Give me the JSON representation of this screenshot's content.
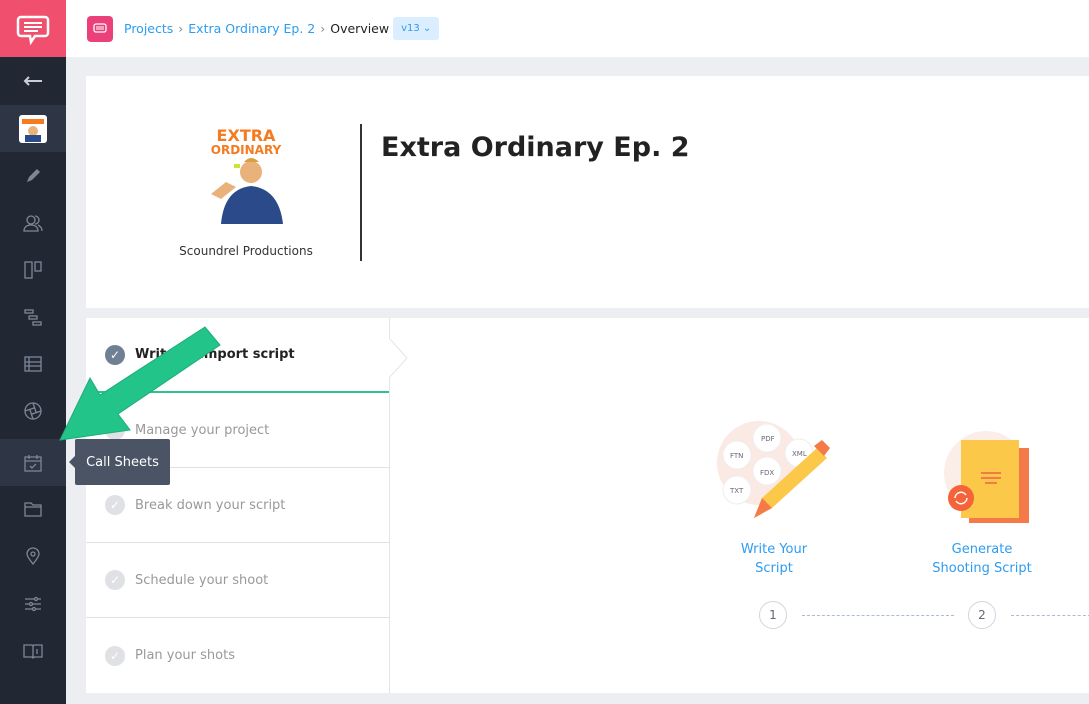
{
  "breadcrumb": {
    "items": [
      "Projects",
      "Extra Ordinary Ep. 2"
    ],
    "current": "Overview",
    "version": "v13 ⌄"
  },
  "project": {
    "title": "Extra Ordinary Ep. 2",
    "company": "Scoundrel Productions",
    "poster_text": "EXTRA ORDINARY"
  },
  "sidebar": {
    "items": [
      "back",
      "project",
      "script",
      "cast",
      "board",
      "schedule",
      "breakdown",
      "shots",
      "call-sheets",
      "files",
      "locations",
      "settings",
      "help"
    ],
    "tooltip": "Call Sheets"
  },
  "steps": [
    {
      "label": "Write or import script",
      "active": true
    },
    {
      "label": "Manage your project"
    },
    {
      "label": "Break down your script"
    },
    {
      "label": "Schedule your shoot"
    },
    {
      "label": "Plan your shots"
    }
  ],
  "features": [
    {
      "line1": "Write Your",
      "line2": "Script",
      "num": "1",
      "formats": [
        "PDF",
        "FTN",
        "XML",
        "FDX",
        "TXT"
      ]
    },
    {
      "line1": "Generate",
      "line2": "Shooting Script",
      "num": "2"
    }
  ],
  "colors": {
    "brand": "#f0506e",
    "link": "#2d9cf0",
    "accent": "#2ec28e",
    "sidebar": "#222833"
  }
}
